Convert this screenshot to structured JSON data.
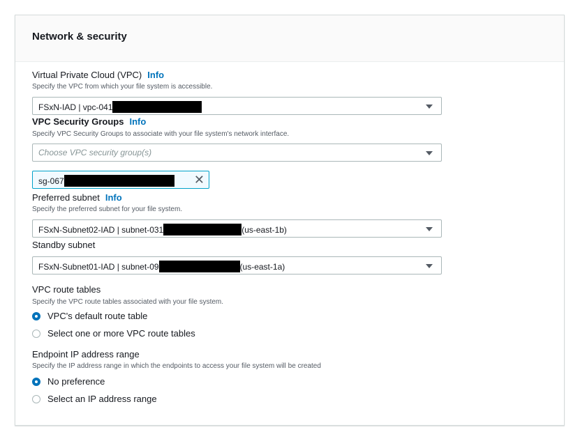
{
  "panel": {
    "title": "Network & security"
  },
  "vpc": {
    "label": "Virtual Private Cloud (VPC)",
    "info": "Info",
    "description": "Specify the VPC from which your file system is accessible.",
    "value_prefix": "FSxN-IAD | vpc-041"
  },
  "security_groups": {
    "label": "VPC Security Groups",
    "info": "Info",
    "description": "Specify VPC Security Groups to associate with your file system's network interface.",
    "placeholder": "Choose VPC security group(s)",
    "tokens": [
      {
        "prefix": "sg-067",
        "remove_icon": "close-icon"
      }
    ]
  },
  "preferred_subnet": {
    "label": "Preferred subnet",
    "info": "Info",
    "description": "Specify the preferred subnet for your file system.",
    "value_prefix": "FSxN-Subnet02-IAD | subnet-031",
    "value_suffix": "(us-east-1b)"
  },
  "standby_subnet": {
    "label": "Standby subnet",
    "value_prefix": "FSxN-Subnet01-IAD | subnet-09",
    "value_suffix": "(us-east-1a)"
  },
  "route_tables": {
    "label": "VPC route tables",
    "description": "Specify the VPC route tables associated with your file system.",
    "options": [
      {
        "label": "VPC's default route table",
        "selected": true
      },
      {
        "label": "Select one or more VPC route tables",
        "selected": false
      }
    ]
  },
  "endpoint_ip": {
    "label": "Endpoint IP address range",
    "description": "Specify the IP address range in which the endpoints to access your file system will be created",
    "options": [
      {
        "label": "No preference",
        "selected": true
      },
      {
        "label": "Select an IP address range",
        "selected": false
      }
    ]
  },
  "colors": {
    "accent": "#0073bb",
    "token_bg": "#f1faff",
    "token_border": "#00a1c9"
  }
}
